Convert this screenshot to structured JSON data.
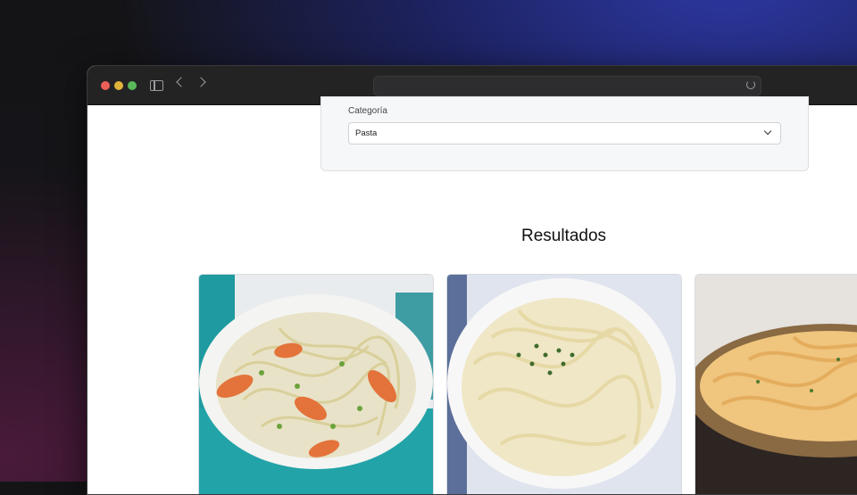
{
  "browser": {
    "address": ""
  },
  "filter": {
    "label": "Categoría",
    "selected": "Pasta"
  },
  "results": {
    "heading": "Resultados",
    "items": [
      {
        "image": "shrimp-linguine-photo"
      },
      {
        "image": "fettuccine-alfredo-photo"
      },
      {
        "image": "creamy-pasta-photo"
      }
    ]
  }
}
